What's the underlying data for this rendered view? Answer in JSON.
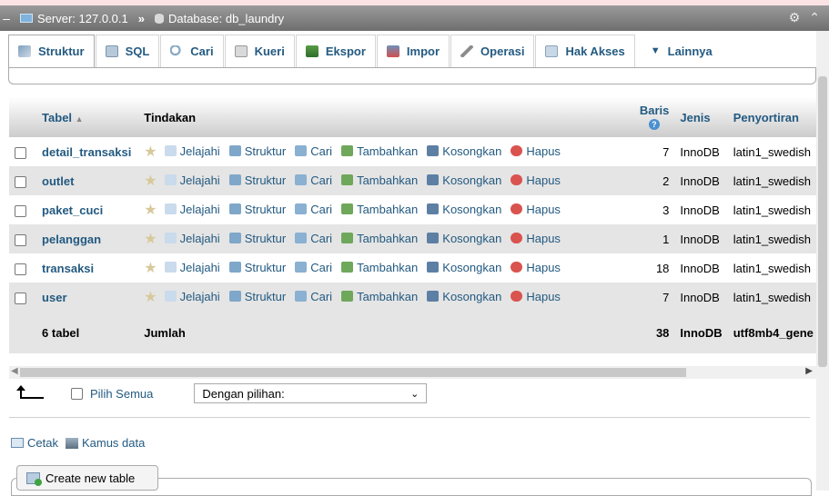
{
  "breadcrumb": {
    "server": "Server: 127.0.0.1",
    "separator": "»",
    "database": "Database: db_laundry"
  },
  "tabs": [
    {
      "label": "Struktur",
      "icon": "structure-icon"
    },
    {
      "label": "SQL",
      "icon": "sql-icon"
    },
    {
      "label": "Cari",
      "icon": "search-icon"
    },
    {
      "label": "Kueri",
      "icon": "query-icon"
    },
    {
      "label": "Ekspor",
      "icon": "export-icon"
    },
    {
      "label": "Impor",
      "icon": "import-icon"
    },
    {
      "label": "Operasi",
      "icon": "wrench-icon"
    },
    {
      "label": "Hak Akses",
      "icon": "privileges-icon"
    },
    {
      "label": "Lainnya",
      "icon": "chevron-down-icon"
    }
  ],
  "table": {
    "headers": {
      "table": "Tabel",
      "sort_indicator": "▲",
      "actions": "Tindakan",
      "rows_line1": "Baris",
      "rows_help": "?",
      "engine": "Jenis",
      "collation": "Penyortiran"
    },
    "actions": {
      "browse": "Jelajahi",
      "structure": "Struktur",
      "search": "Cari",
      "insert": "Tambahkan",
      "empty": "Kosongkan",
      "drop": "Hapus"
    },
    "rows": [
      {
        "name": "detail_transaksi",
        "rows": "7",
        "engine": "InnoDB",
        "collation": "latin1_swedish"
      },
      {
        "name": "outlet",
        "rows": "2",
        "engine": "InnoDB",
        "collation": "latin1_swedish"
      },
      {
        "name": "paket_cuci",
        "rows": "3",
        "engine": "InnoDB",
        "collation": "latin1_swedish"
      },
      {
        "name": "pelanggan",
        "rows": "1",
        "engine": "InnoDB",
        "collation": "latin1_swedish"
      },
      {
        "name": "transaksi",
        "rows": "18",
        "engine": "InnoDB",
        "collation": "latin1_swedish"
      },
      {
        "name": "user",
        "rows": "7",
        "engine": "InnoDB",
        "collation": "latin1_swedish"
      }
    ],
    "footer": {
      "count": "6 tabel",
      "sum_label": "Jumlah",
      "rows": "38",
      "engine": "InnoDB",
      "collation": "utf8mb4_gene"
    }
  },
  "bulk": {
    "select_all": "Pilih Semua",
    "with_selected": "Dengan pilihan:"
  },
  "links": {
    "print": "Cetak",
    "data_dictionary": "Kamus data"
  },
  "create_table": "Create new table",
  "colors": {
    "link": "#235a81",
    "header_gradient_top": "#ffffff",
    "header_gradient_bottom": "#cccccc",
    "row_even": "#e5e5e5",
    "topbar": "#7a7a7a"
  }
}
